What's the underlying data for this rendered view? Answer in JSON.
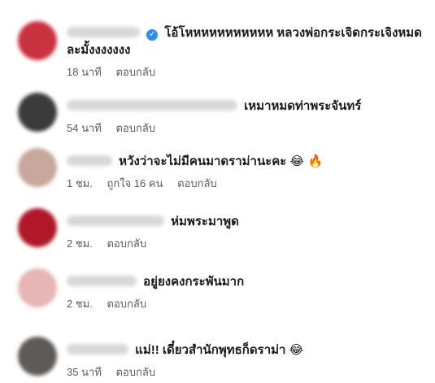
{
  "comments": [
    {
      "text_line1": "โอ้โหหหหหหหหหหห หลวงพ่อกระเจิดกระเจิงหมด",
      "text_line2": "ละมั้งงงงงงง",
      "time": "18 นาที",
      "reply": "ตอบกลับ",
      "verified": true,
      "avatar_color": "#c9323f"
    },
    {
      "text_line1": "เหมาหมดท่าพระจันทร์",
      "time": "54 นาที",
      "reply": "ตอบกลับ",
      "avatar_color": "#3b3b3b"
    },
    {
      "text_line1": "หวังว่าจะไม่มีคนมาดราม่านะคะ",
      "emoji": "😂 🔥",
      "time": "1 ชม.",
      "likes": "ถูกใจ 16 คน",
      "reply": "ตอบกลับ",
      "avatar_color": "#c8a89c"
    },
    {
      "text_line1": "ห่มพระมาพูด",
      "time": "2 ชม.",
      "reply": "ตอบกลับ",
      "avatar_color": "#b01828"
    },
    {
      "text_line1": "อยู่ยงคงกระพันมาก",
      "time": "2 ชม.",
      "reply": "ตอบกลับ",
      "avatar_color": "#e6b5b5"
    },
    {
      "text_line1": "แม่!! เดี๋ยวสำนักพุทธก็ดราม่า",
      "emoji": "😂",
      "time": "35 นาที",
      "reply": "ตอบกลับ",
      "avatar_color": "#5e5a57"
    }
  ]
}
